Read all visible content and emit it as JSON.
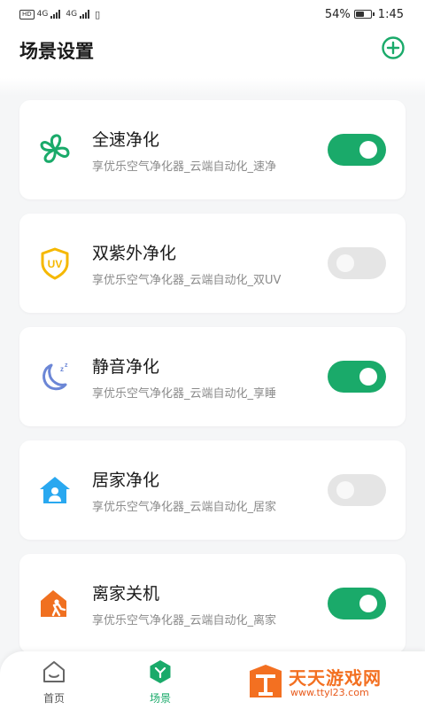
{
  "status_bar": {
    "left_indicators": "HD 4G 4G",
    "battery": "54%",
    "time": "1:45"
  },
  "header": {
    "title": "场景设置",
    "add_icon": "plus-circle-icon"
  },
  "scenes": [
    {
      "title": "全速净化",
      "subtitle": "享优乐空气净化器_云端自动化_速净",
      "icon": "fan-icon",
      "icon_color": "#1aaa6a",
      "enabled": true
    },
    {
      "title": "双紫外净化",
      "subtitle": "享优乐空气净化器_云端自动化_双UV",
      "icon": "uv-shield-icon",
      "icon_color": "#f5b800",
      "icon_text": "UV",
      "enabled": false
    },
    {
      "title": "静音净化",
      "subtitle": "享优乐空气净化器_云端自动化_享睡",
      "icon": "moon-sleep-icon",
      "icon_color": "#6b86d6",
      "enabled": true
    },
    {
      "title": "居家净化",
      "subtitle": "享优乐空气净化器_云端自动化_居家",
      "icon": "home-person-icon",
      "icon_color": "#29a8f0",
      "enabled": false
    },
    {
      "title": "离家关机",
      "subtitle": "享优乐空气净化器_云端自动化_离家",
      "icon": "leave-home-icon",
      "icon_color": "#f07020",
      "enabled": true
    }
  ],
  "nav": {
    "home_label": "首页",
    "scene_label": "场景"
  },
  "watermark": {
    "text": "天天游戏网",
    "url": "www.ttyl23.com"
  },
  "colors": {
    "accent": "#1aaa6a",
    "toggle_off": "#e5e5e5"
  }
}
